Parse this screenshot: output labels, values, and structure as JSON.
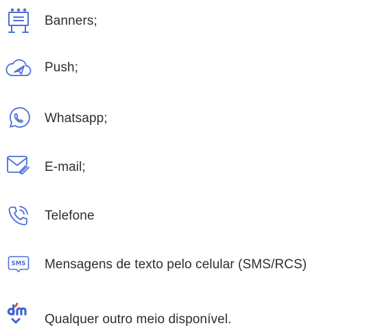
{
  "colors": {
    "icon": "#4a6fd8",
    "text": "#2b2d33",
    "background": "#ffffff"
  },
  "channels": [
    {
      "icon": "billboard-icon",
      "label": "Banners;"
    },
    {
      "icon": "cloud-send-icon",
      "label": "Push;"
    },
    {
      "icon": "whatsapp-icon",
      "label": "Whatsapp;"
    },
    {
      "icon": "email-icon",
      "label": "E-mail;"
    },
    {
      "icon": "phone-call-icon",
      "label": "Telefone"
    },
    {
      "icon": "sms-icon",
      "label": "Mensagens de texto pelo celular (SMS/RCS)"
    },
    {
      "icon": "dm-logo-icon",
      "label": "Qualquer outro meio disponível."
    }
  ]
}
